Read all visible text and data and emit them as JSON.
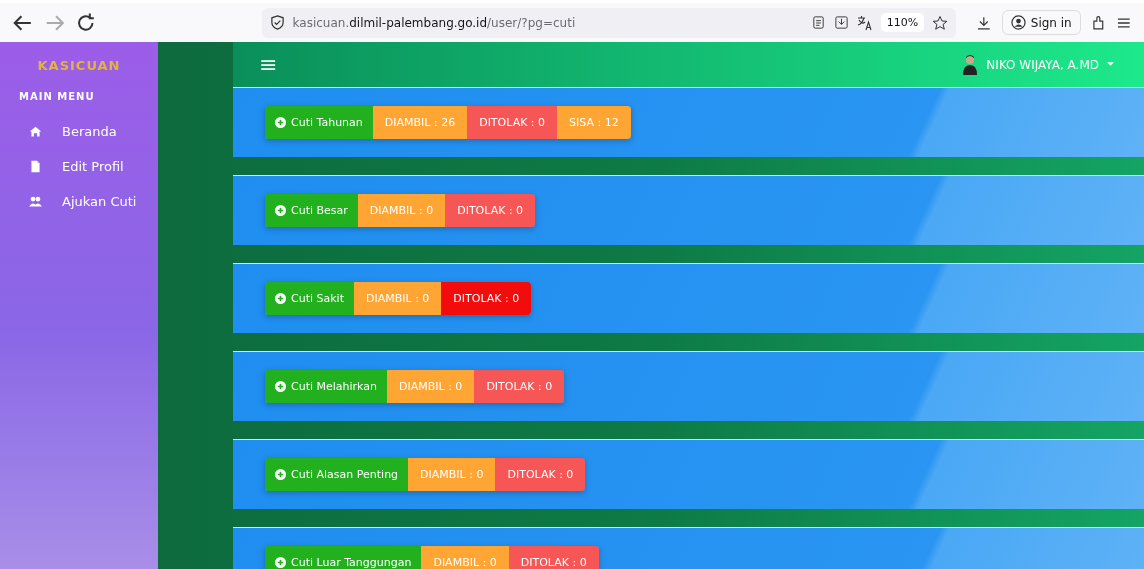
{
  "browser": {
    "url": "kasicuan.**dilmil-palembang.go.id**/user/?pg=cuti",
    "zoom": "110%",
    "sign_in": "Sign in"
  },
  "sidebar": {
    "brand": "KASICUAN",
    "section": "MAIN MENU",
    "items": [
      {
        "label": "Beranda"
      },
      {
        "label": "Edit Profil"
      },
      {
        "label": "Ajukan Cuti"
      }
    ]
  },
  "header": {
    "menu_icon": "≡",
    "user": "NIKO WIJAYA, A.MD"
  },
  "leave_types": [
    {
      "label": "Cuti Tahunan",
      "badges": [
        {
          "text": "DIAMBIL : 26",
          "color": "#ffa534"
        },
        {
          "text": "DITOLAK : 0",
          "color": "#f75656"
        },
        {
          "text": "SISA : 12",
          "color": "#ffa534"
        }
      ]
    },
    {
      "label": "Cuti Besar",
      "badges": [
        {
          "text": "DIAMBIL : 0",
          "color": "#ffa534"
        },
        {
          "text": "DITOLAK : 0",
          "color": "#f75656"
        }
      ]
    },
    {
      "label": "Cuti Sakit",
      "badges": [
        {
          "text": "DIAMBIL : 0",
          "color": "#ffa534"
        },
        {
          "text": "DITOLAK : 0",
          "color": "#f20c0c"
        }
      ]
    },
    {
      "label": "Cuti Melahirkan",
      "badges": [
        {
          "text": "DIAMBIL : 0",
          "color": "#ffa534"
        },
        {
          "text": "DITOLAK : 0",
          "color": "#f75656"
        }
      ]
    },
    {
      "label": "Cuti Alasan Penting",
      "badges": [
        {
          "text": "DIAMBIL : 0",
          "color": "#ffa534"
        },
        {
          "text": "DITOLAK : 0",
          "color": "#f75656"
        }
      ]
    },
    {
      "label": "Cuti Luar Tanggungan",
      "badges": [
        {
          "text": "DIAMBIL : 0",
          "color": "#ffa534"
        },
        {
          "text": "DITOLAK : 0",
          "color": "#f75656"
        }
      ]
    }
  ]
}
